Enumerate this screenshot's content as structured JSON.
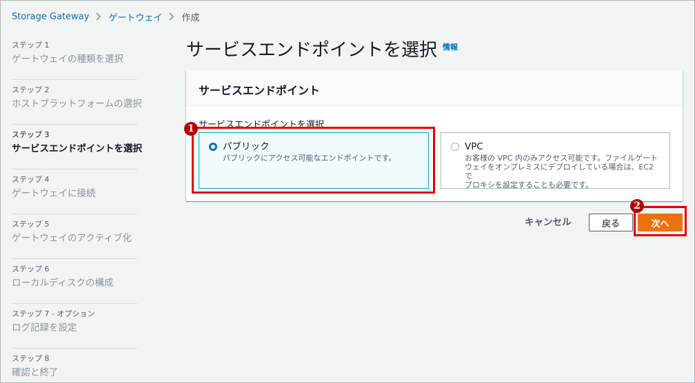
{
  "breadcrumb": {
    "items": [
      {
        "label": "Storage Gateway"
      },
      {
        "label": "ゲートウェイ"
      },
      {
        "label": "作成"
      }
    ]
  },
  "steps": [
    {
      "number": "ステップ 1",
      "title": "ゲートウェイの種類を選択"
    },
    {
      "number": "ステップ 2",
      "title": "ホストプラットフォームの選択"
    },
    {
      "number": "ステップ 3",
      "title": "サービスエンドポイントを選択"
    },
    {
      "number": "ステップ 4",
      "title": "ゲートウェイに接続"
    },
    {
      "number": "ステップ 5",
      "title": "ゲートウェイのアクティブ化"
    },
    {
      "number": "ステップ 6",
      "title": "ローカルディスクの構成"
    },
    {
      "number": "ステップ 7 - オプション",
      "title": "ログ記録を設定"
    },
    {
      "number": "ステップ 8",
      "title": "確認と終了"
    }
  ],
  "active_step": 3,
  "page": {
    "title": "サービスエンドポイントを選択",
    "info_link": "情報"
  },
  "panel": {
    "header": "サービスエンドポイント",
    "field_label": "サービスエンドポイントを選択",
    "options": [
      {
        "name": "パブリック",
        "description_lines": [
          "パブリックにアクセス可能なエンドポイントです。"
        ]
      },
      {
        "name": "VPC",
        "description_lines": [
          "お客様の VPC 内のみアクセス可能です。ファイルゲート",
          "ウェイをオンプレミスにデプロイしている場合は、EC2 で",
          "プロキシを設定することも必要です。"
        ]
      }
    ],
    "selected_option": "パブリック"
  },
  "actions": {
    "cancel_label": "キャンセル",
    "back_label": "戻る",
    "next_label": "次へ"
  },
  "annotations": {
    "marker_1": "1",
    "marker_2": "2"
  },
  "colors": {
    "accent": "#0073bb",
    "primary_button": "#ec7211",
    "highlight": "#e00000"
  }
}
